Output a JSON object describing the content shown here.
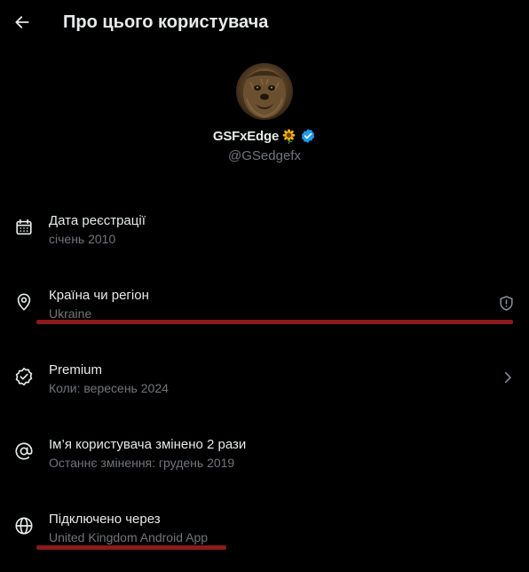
{
  "header": {
    "title": "Про цього користувача"
  },
  "profile": {
    "display_name": "GSFxEdge",
    "name_emoji": "sunflower",
    "verified": true,
    "handle": "@GSedgefx"
  },
  "about": {
    "registration": {
      "title": "Дата реєстрації",
      "value": "січень 2010",
      "icon": "calendar-icon"
    },
    "country": {
      "title": "Країна чи регіон",
      "value": "Ukraine",
      "icon": "location-pin-icon",
      "side_icon": "shield-alert-icon"
    },
    "premium": {
      "title": "Premium",
      "value": "Коли: вересень 2024",
      "icon": "verified-badge-outline-icon",
      "side_icon": "chevron-right-icon"
    },
    "username_changes": {
      "title": "Ім’я користувача змінено 2 рази",
      "value": "Останнє змінення: грудень 2019",
      "icon": "at-sign-icon"
    },
    "connected_via": {
      "title": "Підключено через",
      "value": "United Kingdom Android App",
      "icon": "globe-icon"
    }
  },
  "colors": {
    "background": "#000000",
    "primary_text": "#e7e9ea",
    "secondary_text": "#71767b",
    "verified_blue": "#1d9bf0",
    "annotation_red": "#8b1a1a"
  }
}
